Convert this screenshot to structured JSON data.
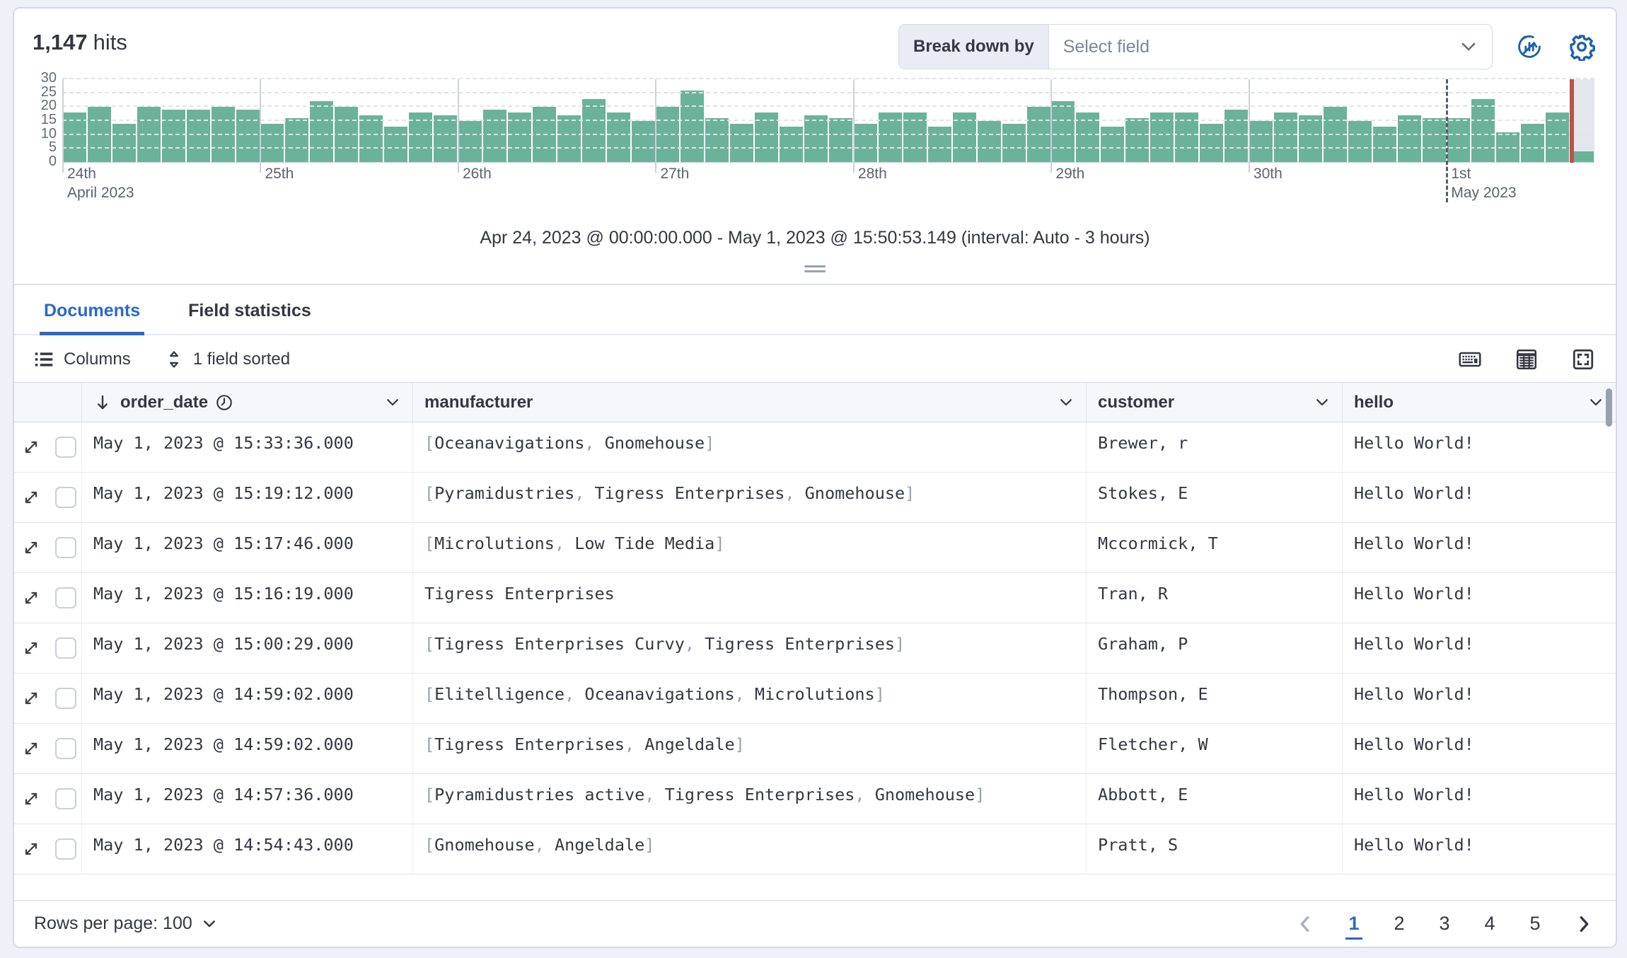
{
  "header": {
    "hits_count": "1,147",
    "hits_label": "hits",
    "breakdown_label": "Break down by",
    "breakdown_placeholder": "Select field",
    "icons": [
      "chart-options-icon",
      "gear-icon"
    ]
  },
  "chart_data": {
    "type": "bar",
    "title": "Document count histogram over time",
    "ylabel": "",
    "xlabel": "",
    "ylim": [
      0,
      30
    ],
    "yticks": [
      0,
      5,
      10,
      15,
      20,
      25,
      30
    ],
    "grid": "dashed-horizontal",
    "bar_color": "#6bb29a",
    "now_marker_color": "#b95449",
    "partial_bucket_shaded": true,
    "interval": "3 hours",
    "bars_per_day": 8,
    "day_ticks": [
      {
        "index": 0,
        "label": "24th",
        "sublabel": "April 2023",
        "style": "solid"
      },
      {
        "index": 8,
        "label": "25th",
        "sublabel": "",
        "style": "solid"
      },
      {
        "index": 16,
        "label": "26th",
        "sublabel": "",
        "style": "solid"
      },
      {
        "index": 24,
        "label": "27th",
        "sublabel": "",
        "style": "solid"
      },
      {
        "index": 32,
        "label": "28th",
        "sublabel": "",
        "style": "solid"
      },
      {
        "index": 40,
        "label": "29th",
        "sublabel": "",
        "style": "solid"
      },
      {
        "index": 48,
        "label": "30th",
        "sublabel": "",
        "style": "solid"
      },
      {
        "index": 56,
        "label": "1st",
        "sublabel": "May 2023",
        "style": "dashed-dark"
      }
    ],
    "values": [
      18,
      20,
      14,
      20,
      19,
      19,
      20,
      19,
      14,
      16,
      22,
      20,
      17,
      13,
      18,
      17,
      15,
      19,
      18,
      20,
      17,
      23,
      18,
      15,
      20,
      26,
      16,
      14,
      18,
      13,
      17,
      16,
      14,
      18,
      18,
      13,
      18,
      15,
      14,
      20,
      22,
      18,
      13,
      16,
      18,
      18,
      14,
      19,
      15,
      18,
      17,
      20,
      15,
      13,
      17,
      16,
      16,
      23,
      11,
      14,
      18,
      4
    ],
    "partial_last_bucket": true
  },
  "caption": "Apr 24, 2023 @ 00:00:00.000 - May 1, 2023 @ 15:50:53.149 (interval: Auto - 3 hours)",
  "tabs": [
    {
      "label": "Documents",
      "active": true
    },
    {
      "label": "Field statistics",
      "active": false
    }
  ],
  "toolbar": {
    "columns_label": "Columns",
    "sorted_label": "1 field sorted",
    "right_icons": [
      "keyboard-icon",
      "display-density-icon",
      "fullscreen-icon"
    ]
  },
  "grid": {
    "columns": [
      {
        "label": "order_date",
        "sorted_desc": true,
        "type_icon": "clock-icon"
      },
      {
        "label": "manufacturer"
      },
      {
        "label": "customer"
      },
      {
        "label": "hello"
      }
    ],
    "rows": [
      {
        "order_date": "May 1, 2023 @ 15:33:36.000",
        "manufacturer": [
          "Oceanavigations",
          "Gnomehouse"
        ],
        "customer": "Brewer, r",
        "hello": "Hello World!"
      },
      {
        "order_date": "May 1, 2023 @ 15:19:12.000",
        "manufacturer": [
          "Pyramidustries",
          "Tigress Enterprises",
          "Gnomehouse"
        ],
        "customer": "Stokes, E",
        "hello": "Hello World!"
      },
      {
        "order_date": "May 1, 2023 @ 15:17:46.000",
        "manufacturer": [
          "Microlutions",
          "Low Tide Media"
        ],
        "customer": "Mccormick, T",
        "hello": "Hello World!"
      },
      {
        "order_date": "May 1, 2023 @ 15:16:19.000",
        "manufacturer": "Tigress Enterprises",
        "customer": "Tran, R",
        "hello": "Hello World!"
      },
      {
        "order_date": "May 1, 2023 @ 15:00:29.000",
        "manufacturer": [
          "Tigress Enterprises Curvy",
          "Tigress Enterprises"
        ],
        "customer": "Graham, P",
        "hello": "Hello World!"
      },
      {
        "order_date": "May 1, 2023 @ 14:59:02.000",
        "manufacturer": [
          "Elitelligence",
          "Oceanavigations",
          "Microlutions"
        ],
        "customer": "Thompson, E",
        "hello": "Hello World!"
      },
      {
        "order_date": "May 1, 2023 @ 14:59:02.000",
        "manufacturer": [
          "Tigress Enterprises",
          "Angeldale"
        ],
        "customer": "Fletcher, W",
        "hello": "Hello World!"
      },
      {
        "order_date": "May 1, 2023 @ 14:57:36.000",
        "manufacturer": [
          "Pyramidustries active",
          "Tigress Enterprises",
          "Gnomehouse"
        ],
        "customer": "Abbott, E",
        "hello": "Hello World!"
      },
      {
        "order_date": "May 1, 2023 @ 14:54:43.000",
        "manufacturer": [
          "Gnomehouse",
          "Angeldale"
        ],
        "customer": "Pratt, S",
        "hello": "Hello World!"
      }
    ]
  },
  "footer": {
    "rows_per_page_label": "Rows per page: 100",
    "pages": [
      "1",
      "2",
      "3",
      "4",
      "5"
    ],
    "active_page": "1",
    "prev_icon": "chevron-left-icon",
    "next_icon": "chevron-right-icon"
  },
  "colors": {
    "accent_blue": "#2a6bc5",
    "icon_blue": "#1e5fae",
    "bar_green": "#6bb29a",
    "now_marker_red": "#b95449",
    "page_background": "#eff1f8",
    "panel_border": "#d3dae6",
    "text_main": "#343741",
    "text_subdued": "#646b79"
  }
}
